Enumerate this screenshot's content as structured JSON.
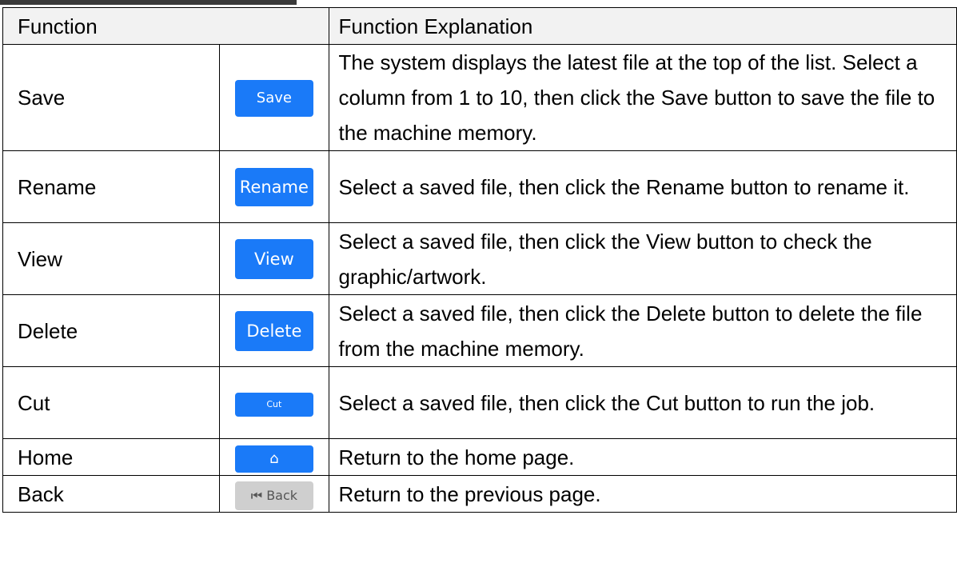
{
  "header": {
    "function": "Function",
    "explanation": "Function Explanation"
  },
  "rows": [
    {
      "name": "Save",
      "button": "Save",
      "explanation": "The system displays the latest file at the top of the list. Select a column from 1 to 10, then click the Save button to save the file to the machine memory."
    },
    {
      "name": "Rename",
      "button": "Rename",
      "explanation": "Select a saved file, then click the Rename button to rename it."
    },
    {
      "name": "View",
      "button": "View",
      "explanation": "Select a saved file, then click the View button to check the graphic/artwork."
    },
    {
      "name": "Delete",
      "button": "Delete",
      "explanation": "Select a saved file, then click the Delete button to delete the file from the machine memory."
    },
    {
      "name": "Cut",
      "button": "Cut",
      "explanation": "Select a saved file, then click the Cut button to run the job."
    },
    {
      "name": "Home",
      "button_icon": "home-icon",
      "button_glyph": "⌂",
      "explanation": "Return to the home page."
    },
    {
      "name": "Back",
      "button": "Back",
      "button_icon": "skip-back-icon",
      "button_glyph": "⏮",
      "explanation": "Return to the previous page."
    }
  ],
  "colors": {
    "button_blue": "#1a7af8",
    "button_gray": "#cfcfcf",
    "header_bg": "#f2f2f2"
  }
}
